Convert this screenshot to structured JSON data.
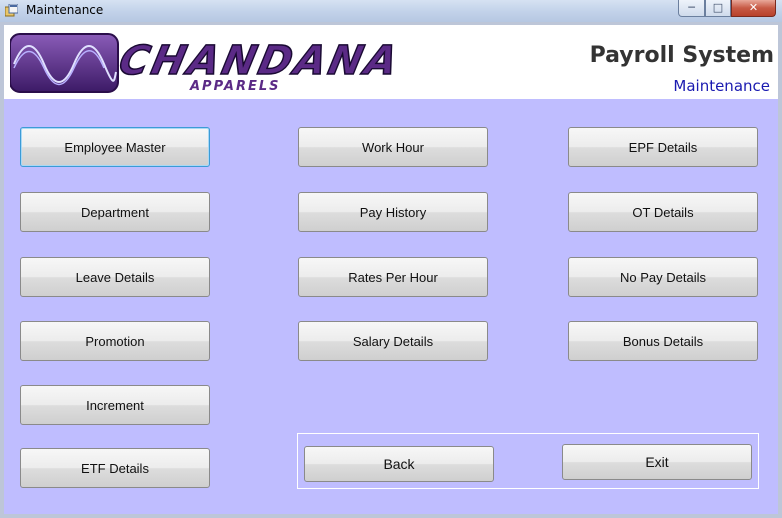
{
  "window": {
    "title": "Maintenance",
    "controls": {
      "minimize": "─",
      "maximize": "□",
      "close": "✕"
    }
  },
  "header": {
    "logo_text": "CHANDANA",
    "logo_subtext": "APPARELS",
    "system_title": "Payroll System",
    "section_title": "Maintenance",
    "colors": {
      "logo_purple": "#5b2a86",
      "section_blue": "#1a1ab0"
    }
  },
  "buttons": {
    "employee_master": "Employee Master",
    "department": "Department",
    "leave_details": "Leave Details",
    "promotion": "Promotion",
    "increment": "Increment",
    "etf_details": "ETF Details",
    "work_hour": "Work Hour",
    "pay_history": "Pay History",
    "rates_per_hour": "Rates Per Hour",
    "salary_details": "Salary Details",
    "epf_details": "EPF Details",
    "ot_details": "OT Details",
    "no_pay_details": "No Pay Details",
    "bonus_details": "Bonus Details",
    "back": "Back",
    "exit": "Exit"
  },
  "colors": {
    "client_background": "#bfbdff",
    "focus_border": "#3c9bd6"
  }
}
